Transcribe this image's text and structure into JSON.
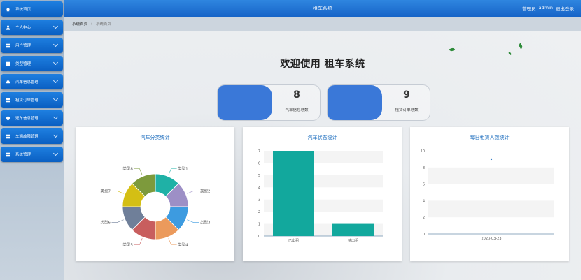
{
  "sidebar": {
    "items": [
      {
        "label": "系统首页",
        "icon": "home-icon",
        "expandable": false
      },
      {
        "label": "个人中心",
        "icon": "user-icon",
        "expandable": true
      },
      {
        "label": "用户管理",
        "icon": "grid-icon",
        "expandable": true
      },
      {
        "label": "类型管理",
        "icon": "grid-icon",
        "expandable": true
      },
      {
        "label": "汽车信息管理",
        "icon": "car-icon",
        "expandable": true
      },
      {
        "label": "租赁订单管理",
        "icon": "grid-icon",
        "expandable": true
      },
      {
        "label": "还车信息管理",
        "icon": "shield-icon",
        "expandable": true
      },
      {
        "label": "车辆故障管理",
        "icon": "grid-icon",
        "expandable": true
      },
      {
        "label": "系统管理",
        "icon": "grid-icon",
        "expandable": true
      }
    ]
  },
  "header": {
    "title": "租车系统",
    "role": "管理员",
    "username": "admin",
    "logout": "退出登录"
  },
  "breadcrumb": {
    "home": "系统首页",
    "separator": "/",
    "current": "系统首页"
  },
  "main": {
    "welcome": "欢迎使用 租车系统",
    "stats": [
      {
        "value": "8",
        "label": "汽车信息总数"
      },
      {
        "value": "9",
        "label": "租赁订单总数"
      }
    ],
    "panels": {
      "pie_title": "汽车分类统计",
      "bar_title": "汽车状态统计",
      "line_title": "每日租赁人数统计"
    }
  },
  "colors": {
    "accent": "#1664c8",
    "teal": "#12a89d"
  },
  "chart_data": [
    {
      "type": "pie",
      "title": "汽车分类统计",
      "labels": [
        "类型1",
        "类型2",
        "类型3",
        "类型4",
        "类型5",
        "类型6",
        "类型7",
        "类型8"
      ],
      "values": [
        1,
        1,
        1,
        1,
        1,
        1,
        1,
        1
      ],
      "colors": [
        "#1fb1a6",
        "#9d8fc6",
        "#3d9be0",
        "#eb9a5c",
        "#c85e5e",
        "#6f7f99",
        "#d4bf14",
        "#7d9a3c"
      ]
    },
    {
      "type": "bar",
      "title": "汽车状态统计",
      "categories": [
        "已出租",
        "待出租"
      ],
      "values": [
        7,
        1
      ],
      "ylim": [
        0,
        7
      ],
      "yticks": [
        0,
        1,
        2,
        3,
        4,
        5,
        6,
        7
      ]
    },
    {
      "type": "scatter",
      "title": "每日租赁人数统计",
      "x": [
        "2023-03-23"
      ],
      "y": [
        9
      ],
      "ylim": [
        0,
        10
      ],
      "yticks": [
        0,
        2,
        4,
        6,
        8,
        10
      ]
    }
  ]
}
